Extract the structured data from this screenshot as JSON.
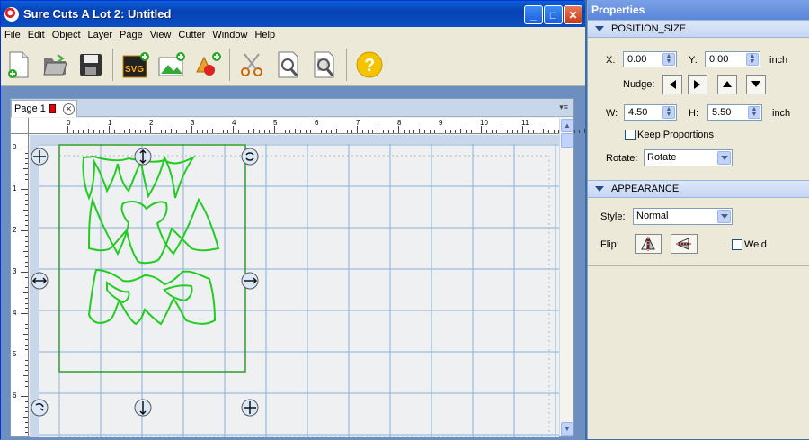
{
  "window": {
    "title": "Sure Cuts A Lot 2: Untitled"
  },
  "menu": [
    "File",
    "Edit",
    "Object",
    "Layer",
    "Page",
    "View",
    "Cutter",
    "Window",
    "Help"
  ],
  "toolbar": {
    "icons": [
      "new-document-icon",
      "open-folder-icon",
      "save-disk-icon",
      "import-svg-icon",
      "add-image-icon",
      "add-shape-icon",
      "scissors-cut-icon",
      "zoom-page-icon",
      "zoom-fit-icon",
      "help-icon"
    ],
    "svg_label": "SVG"
  },
  "document": {
    "tab_label": "Page 1",
    "tab_color": "#d00000",
    "ruler_top_labels": [
      "0",
      "1",
      "2",
      "3",
      "4",
      "5",
      "6",
      "7",
      "8",
      "9",
      "10",
      "11"
    ],
    "ruler_left_labels": [
      "0",
      "1",
      "2",
      "3",
      "4",
      "5",
      "6"
    ]
  },
  "properties": {
    "panel_title": "Properties",
    "position_size": {
      "header": "POSITION_SIZE",
      "x_label": "X:",
      "x_value": "0.00",
      "y_label": "Y:",
      "y_value": "0.00",
      "xy_unit": "inch",
      "nudge_label": "Nudge:",
      "w_label": "W:",
      "w_value": "4.50",
      "h_label": "H:",
      "h_value": "5.50",
      "wh_unit": "inch",
      "keep_proportions_label": "Keep Proportions",
      "keep_proportions_checked": false,
      "rotate_label": "Rotate:",
      "rotate_value": "Rotate"
    },
    "appearance": {
      "header": "APPEARANCE",
      "style_label": "Style:",
      "style_value": "Normal",
      "flip_label": "Flip:",
      "weld_label": "Weld",
      "weld_checked": false
    }
  },
  "colors": {
    "design_stroke": "#22cc22",
    "grid_line": "#8ab0d8",
    "selection_box": "#2aa02a",
    "titlebar": "#0842b5"
  }
}
